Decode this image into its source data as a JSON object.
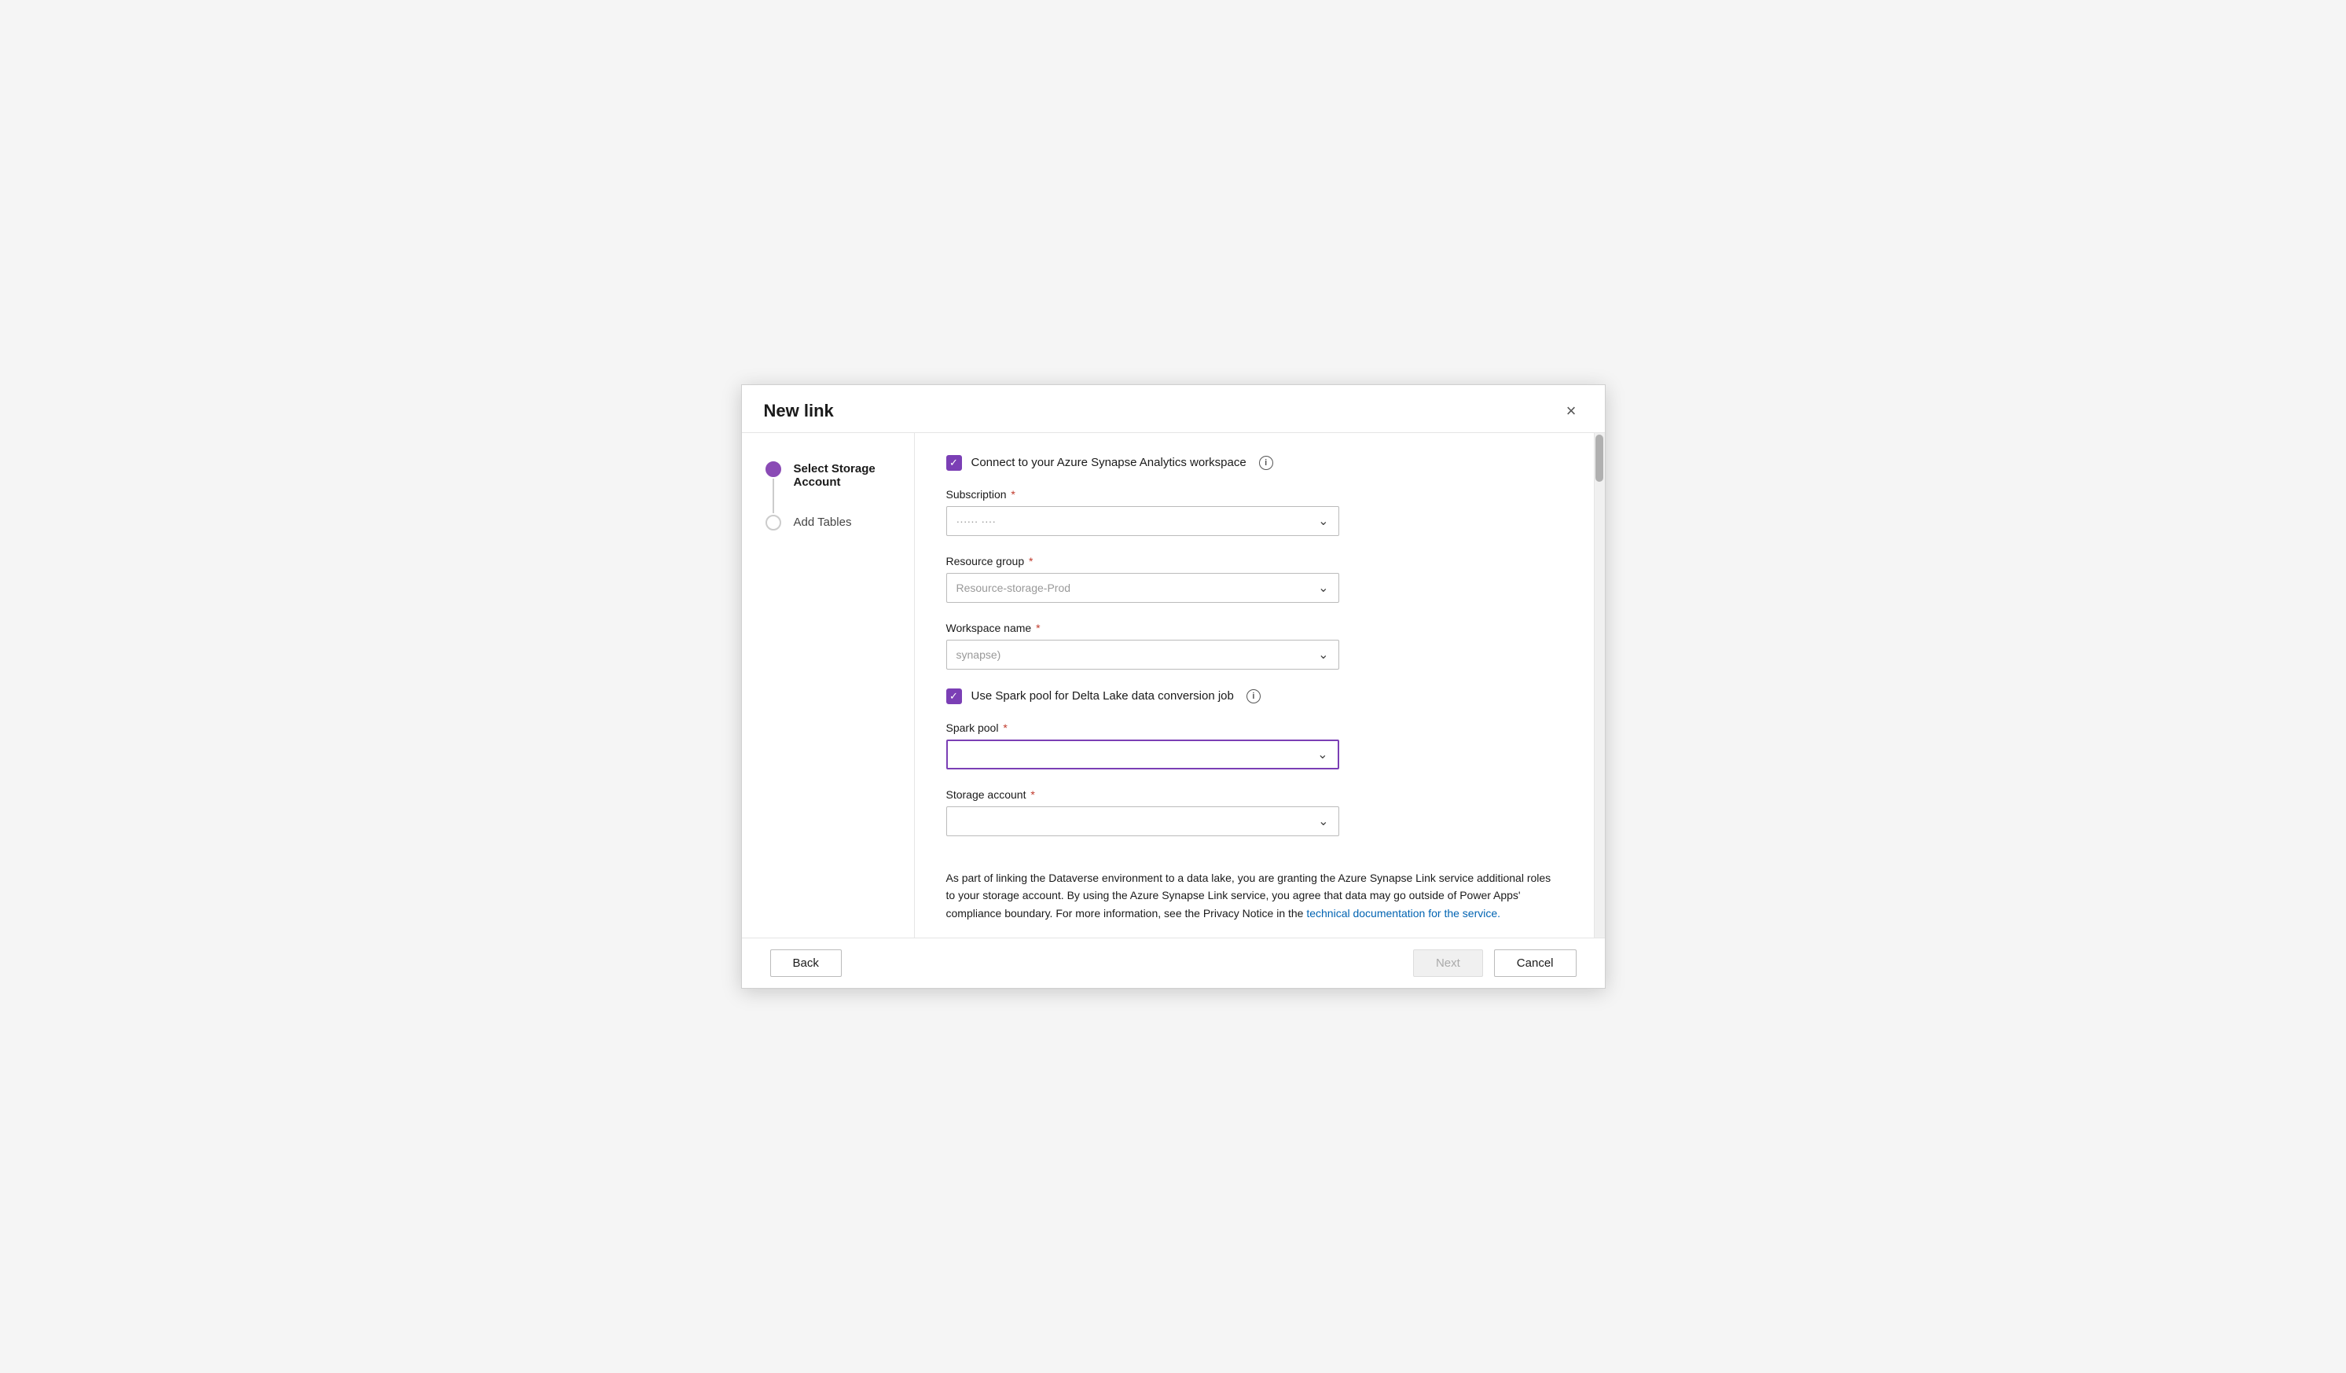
{
  "dialog": {
    "title": "New link",
    "close_label": "×"
  },
  "sidebar": {
    "steps": [
      {
        "id": "select-storage",
        "label": "Select Storage Account",
        "active": true
      },
      {
        "id": "add-tables",
        "label": "Add Tables",
        "active": false
      }
    ]
  },
  "form": {
    "connect_checkbox_label": "Connect to your Azure Synapse Analytics workspace",
    "connect_checked": true,
    "subscription_label": "Subscription",
    "subscription_value": "······ ····",
    "resource_group_label": "Resource group",
    "resource_group_value": "Resource-storage-Prod",
    "workspace_name_label": "Workspace name",
    "workspace_name_value": "synapse)",
    "spark_pool_checkbox_label": "Use Spark pool for Delta Lake data conversion job",
    "spark_pool_checked": true,
    "spark_pool_label": "Spark pool",
    "spark_pool_value": "",
    "storage_account_label": "Storage account",
    "storage_account_value": "",
    "disclaimer": "As part of linking the Dataverse environment to a data lake, you are granting the Azure Synapse Link service additional roles to your storage account. By using the Azure Synapse Link service, you agree that data may go outside of Power Apps' compliance boundary. For more information, see the Privacy Notice in the ",
    "disclaimer_link_text": "technical documentation for the service.",
    "disclaimer_link_url": "#"
  },
  "footer": {
    "back_label": "Back",
    "next_label": "Next",
    "cancel_label": "Cancel"
  },
  "icons": {
    "info": "i",
    "chevron_down": "⌄",
    "checkmark": "✓",
    "close": "✕"
  }
}
